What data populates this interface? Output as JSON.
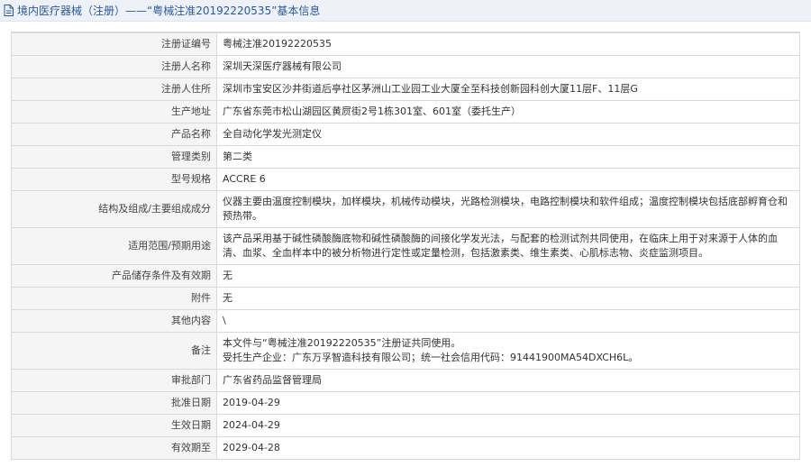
{
  "header": {
    "title": "境内医疗器械（注册）——“粤械注准20192220535”基本信息"
  },
  "rows": [
    {
      "label": "注册证编号",
      "value": "粤械注准20192220535"
    },
    {
      "label": "注册人名称",
      "value": "深圳天深医疗器械有限公司"
    },
    {
      "label": "注册人住所",
      "value": "深圳市宝安区沙井街道后亭社区茅洲山工业园工业大厦全至科技创新园科创大厦11层F、11层G"
    },
    {
      "label": "生产地址",
      "value": "广东省东莞市松山湖园区黄屃街2号1栋301室、601室（委托生产）"
    },
    {
      "label": "产品名称",
      "value": "全自动化学发光测定仪"
    },
    {
      "label": "管理类别",
      "value": "第二类"
    },
    {
      "label": "型号规格",
      "value": "ACCRE 6"
    },
    {
      "label": "结构及组成/主要组成成分",
      "value": "仪器主要由温度控制模块，加样模块，机械传动模块，光路检测模块，电路控制模块和软件组成；温度控制模块包括底部孵育仓和预热带。"
    },
    {
      "label": "适用范围/预期用途",
      "value": "该产品采用基于碱性磷酸酶底物和碱性磷酸酶的间接化学发光法，与配套的检测试剂共同使用，在临床上用于对来源于人体的血清、血浆、全血样本中的被分析物进行定性或定量检测，包括激素类、维生素类、心肌标志物、炎症监测项目。"
    },
    {
      "label": "产品储存条件及有效期",
      "value": "无"
    },
    {
      "label": "附件",
      "value": "无"
    },
    {
      "label": "其他内容",
      "value": "\\"
    },
    {
      "label": "备注",
      "value_line1": "本文件与“粤械注准20192220535”注册证共同使用。",
      "value_line2": "受托生产企业：广东万孚智造科技有限公司；统一社会信用代码：91441900MA54DXCH6L。"
    },
    {
      "label": "审批部门",
      "value": "广东省药品监督管理局"
    },
    {
      "label": "批准日期",
      "value": "2019-04-29"
    },
    {
      "label": "生效日期",
      "value": "2024-04-29"
    },
    {
      "label": "有效期至",
      "value": "2029-04-28"
    }
  ]
}
